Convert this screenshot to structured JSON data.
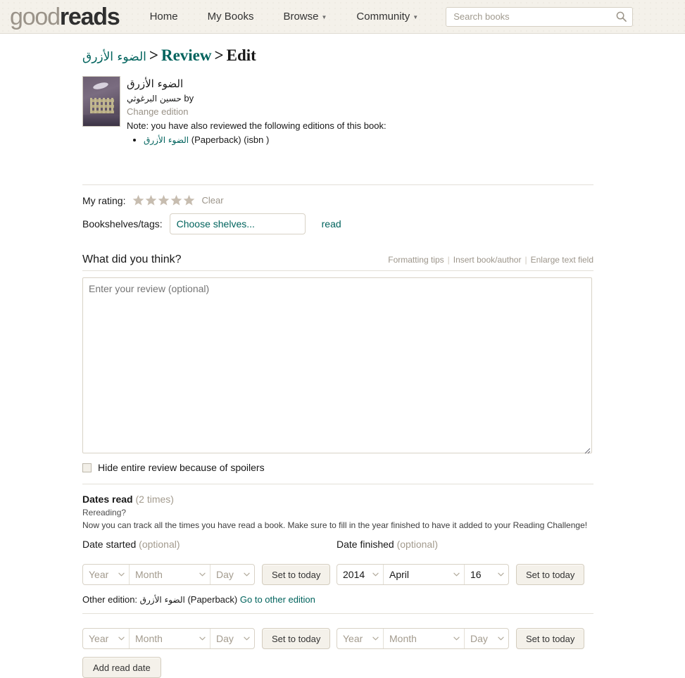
{
  "header": {
    "logo_good": "good",
    "logo_reads": "reads",
    "nav": [
      {
        "label": "Home",
        "caret": false
      },
      {
        "label": "My Books",
        "caret": false
      },
      {
        "label": "Browse",
        "caret": true
      },
      {
        "label": "Community",
        "caret": true
      }
    ],
    "search": {
      "placeholder": "Search books",
      "value": "",
      "icon": "search-icon"
    }
  },
  "breadcrumb": {
    "book_title_ar": "الضوء الأزرق",
    "sep": ">",
    "review": "Review",
    "edit": "Edit"
  },
  "book": {
    "title_ar": "الضوء الأزرق",
    "by_label": "by",
    "author_ar": "حسين البرغوثي",
    "change_edition": "Change edition",
    "also_reviewed_note": "Note: you have also reviewed the following editions of this book:",
    "editions": [
      {
        "title_ar": "الضوء الأزرق",
        "format": "(Paperback)",
        "isbn": "(isbn )"
      }
    ]
  },
  "rating": {
    "label": "My rating:",
    "stars_total": 5,
    "stars_filled": 0,
    "star_color": "#c7bdb0",
    "clear_label": "Clear"
  },
  "shelves": {
    "label": "Bookshelves/tags:",
    "placeholder": "Choose shelves...",
    "value": "",
    "tags": [
      "read"
    ]
  },
  "review": {
    "heading": "What did you think?",
    "tools": [
      "Formatting tips",
      "Insert book/author",
      "Enlarge text field"
    ],
    "placeholder": "Enter your review (optional)",
    "value": "",
    "spoiler_label": "Hide entire review because of spoilers",
    "spoiler_checked": false
  },
  "dates": {
    "title": "Dates read",
    "count": "(2 times)",
    "rereading": "Rereading?",
    "help": "Now you can track all the times you have read a book. Make sure to fill in the year finished to have it added to your Reading Challenge!",
    "started_label": "Date started",
    "finished_label": "Date finished",
    "optional": "(optional)",
    "set_today_label": "Set to today",
    "placeholders": {
      "year": "Year",
      "month": "Month",
      "day": "Day"
    },
    "rows": [
      {
        "started": {
          "year": "",
          "month": "",
          "day": ""
        },
        "finished": {
          "year": "2014",
          "month": "April",
          "day": "16"
        }
      },
      {
        "started": {
          "year": "",
          "month": "",
          "day": ""
        },
        "finished": {
          "year": "",
          "month": "",
          "day": ""
        }
      }
    ],
    "other_edition_prefix": "Other edition:",
    "other_edition_title_ar": "الضوء الأزرق",
    "other_edition_format": "(Paperback)",
    "other_edition_link": "Go to other edition",
    "add_read_date_label": "Add read date"
  },
  "colors": {
    "accent_teal": "#00635d",
    "header_bg": "#f4f1ea",
    "muted": "#a39b8e"
  }
}
